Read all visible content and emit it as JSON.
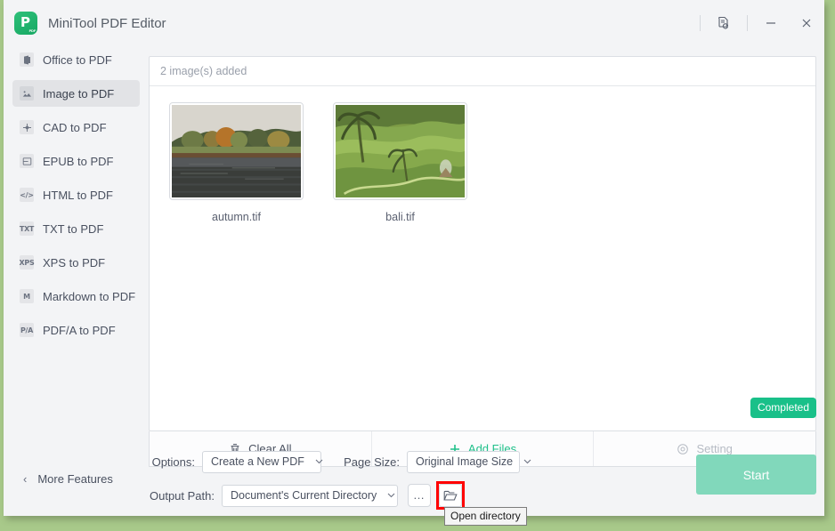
{
  "window": {
    "app_title": "MiniTool PDF Editor",
    "logo_letter": "P",
    "logo_badge": "PDF",
    "controls": [
      {
        "name": "feedback-icon",
        "label": ""
      },
      {
        "name": "minimize-icon",
        "label": ""
      },
      {
        "name": "close-icon",
        "label": ""
      }
    ]
  },
  "sidebar": {
    "items": [
      {
        "label": "Office to PDF",
        "icon_text": "O",
        "icon": "office-icon",
        "active": false
      },
      {
        "label": "Image to PDF",
        "icon_text": "",
        "icon": "image-icon",
        "active": true
      },
      {
        "label": "CAD to PDF",
        "icon_text": "",
        "icon": "cad-icon",
        "active": false
      },
      {
        "label": "EPUB to PDF",
        "icon_text": "",
        "icon": "epub-icon",
        "active": false
      },
      {
        "label": "HTML to PDF",
        "icon_text": "</>",
        "icon": "html-icon",
        "active": false
      },
      {
        "label": "TXT to PDF",
        "icon_text": "TXT",
        "icon": "txt-icon",
        "active": false
      },
      {
        "label": "XPS to PDF",
        "icon_text": "XPS",
        "icon": "xps-icon",
        "active": false
      },
      {
        "label": "Markdown to PDF",
        "icon_text": "M",
        "icon": "markdown-icon",
        "active": false
      },
      {
        "label": "PDF/A to PDF",
        "icon_text": "P/A",
        "icon": "pdfa-icon",
        "active": false
      }
    ],
    "more_features": "More Features"
  },
  "main": {
    "files_count_text": "2 image(s) added",
    "files": [
      {
        "name": "autumn.tif",
        "thumb": "autumn-landscape-thumbnail"
      },
      {
        "name": "bali.tif",
        "thumb": "bali-rice-terrace-thumbnail"
      }
    ],
    "status_badge": "Completed"
  },
  "action_bar": {
    "clear_all": "Clear All",
    "add_files": "Add Files",
    "setting": "Setting"
  },
  "options": {
    "options_label": "Options:",
    "options_value": "Create a New PDF",
    "page_size_label": "Page Size:",
    "page_size_value": "Original Image Size",
    "output_path_label": "Output Path:",
    "output_path_value": "Document's Current Directory",
    "browse_more": "…"
  },
  "start_button": {
    "label": "Start"
  },
  "tooltip": {
    "text": "Open directory"
  },
  "colors": {
    "accent_green": "#1fc08a",
    "badge_green": "#19c089",
    "start_button": "#81d8bb",
    "highlight_red": "#ff0000",
    "desktop": "#a8c98a"
  }
}
